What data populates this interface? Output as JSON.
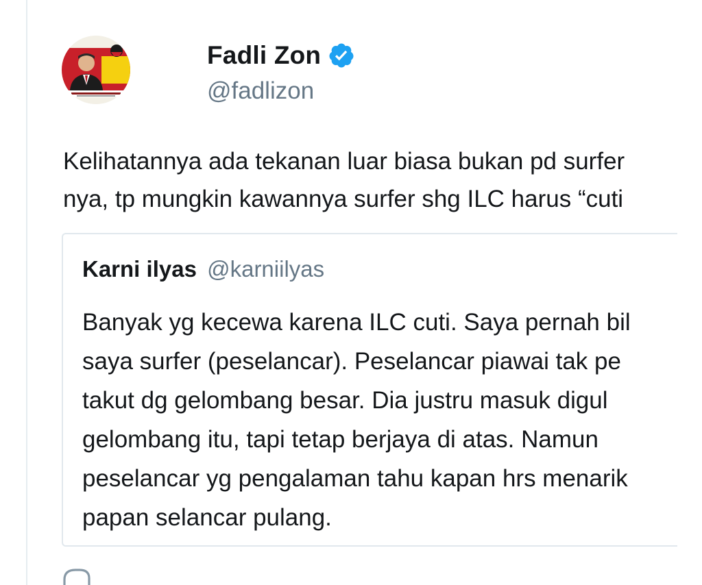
{
  "tweet": {
    "author": {
      "display_name": "Fadli Zon",
      "handle": "@fadlizon",
      "verified": true,
      "avatar_icon": "profile-photo"
    },
    "text_lines": [
      "Kelihatannya ada tekanan luar biasa bukan pd surfer",
      "nya, tp mungkin kawannya surfer shg ILC harus “cuti"
    ],
    "quoted_tweet": {
      "display_name": "Karni ilyas",
      "handle": "@karniilyas",
      "text_lines": [
        "Banyak yg kecewa karena ILC cuti. Saya pernah bil",
        "saya surfer (peselancar). Peselancar piawai tak pe",
        "takut dg gelombang besar. Dia justru masuk digul",
        "gelombang itu, tapi tetap berjaya di atas. Namun",
        "peselancar yg pengalaman tahu kapan hrs menarik",
        "papan selancar pulang."
      ]
    },
    "actions": {
      "reply_icon": "reply-icon"
    }
  },
  "colors": {
    "verified_blue": "#1da1f2",
    "secondary_text": "#657786",
    "primary_text": "#14171a",
    "border": "#e1e8ed"
  }
}
